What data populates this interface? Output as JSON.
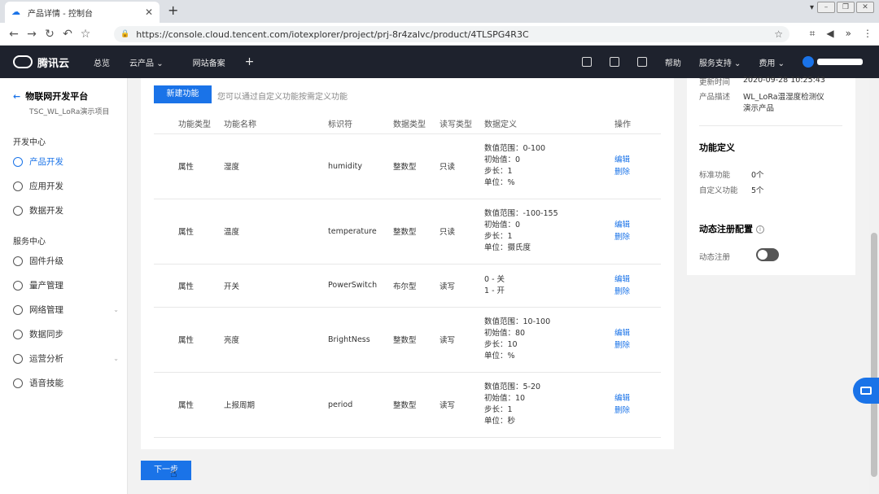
{
  "browser": {
    "tab_title": "产品详情 - 控制台",
    "url": "https://console.cloud.tencent.com/iotexplorer/project/prj-8r4zalvc/product/4TLSPG4R3C"
  },
  "topnav": {
    "brand": "腾讯云",
    "items": [
      "总览",
      "云产品 ⌄",
      "网站备案"
    ],
    "right": [
      "帮助",
      "服务支持 ⌄",
      "费用 ⌄"
    ]
  },
  "sidebar": {
    "platform_title": "物联网开发平台",
    "project_name": "TSC_WL_LoRa演示项目",
    "section_dev": "开发中心",
    "dev_items": [
      "产品开发",
      "应用开发",
      "数据开发"
    ],
    "section_service": "服务中心",
    "service_items": [
      "固件升级",
      "量产管理",
      "网络管理",
      "数据同步",
      "运营分析",
      "语音技能"
    ]
  },
  "main": {
    "new_button": "新建功能",
    "hint": "您可以通过自定义功能按需定义功能",
    "columns": [
      "功能类型",
      "功能名称",
      "标识符",
      "数据类型",
      "读写类型",
      "数据定义",
      "操作"
    ],
    "rows": [
      {
        "type": "属性",
        "name": "湿度",
        "id": "humidity",
        "dtype": "整数型",
        "rw": "只读",
        "def": [
          "数值范围：0-100",
          "初始值：0",
          "步长：1",
          "单位：%"
        ]
      },
      {
        "type": "属性",
        "name": "温度",
        "id": "temperature",
        "dtype": "整数型",
        "rw": "只读",
        "def": [
          "数值范围：-100-155",
          "初始值：0",
          "步长：1",
          "单位：摄氏度"
        ]
      },
      {
        "type": "属性",
        "name": "开关",
        "id": "PowerSwitch",
        "dtype": "布尔型",
        "rw": "读写",
        "def": [
          "0 - 关",
          "1 - 开"
        ]
      },
      {
        "type": "属性",
        "name": "亮度",
        "id": "BrightNess",
        "dtype": "整数型",
        "rw": "读写",
        "def": [
          "数值范围：10-100",
          "初始值：80",
          "步长：10",
          "单位：%"
        ]
      },
      {
        "type": "属性",
        "name": "上报周期",
        "id": "period",
        "dtype": "整数型",
        "rw": "读写",
        "def": [
          "数值范围：5-20",
          "初始值：10",
          "步长：1",
          "单位：秒"
        ]
      }
    ],
    "edit_label": "编辑",
    "delete_label": "删除",
    "next_button": "下一步"
  },
  "right_panel": {
    "updated_label": "更新时间",
    "updated_value": "2020-09-28 10:25:43",
    "desc_label": "产品描述",
    "desc_value_1": "WL_LoRa温湿度检测仪",
    "desc_value_2": "演示产品",
    "func_title": "功能定义",
    "std_label": "标准功能",
    "std_value": "0个",
    "custom_label": "自定义功能",
    "custom_value": "5个",
    "dyn_title": "动态注册配置",
    "dyn_label": "动态注册"
  },
  "colors": {
    "primary": "#1a73e8",
    "topnav": "#1e222d"
  }
}
